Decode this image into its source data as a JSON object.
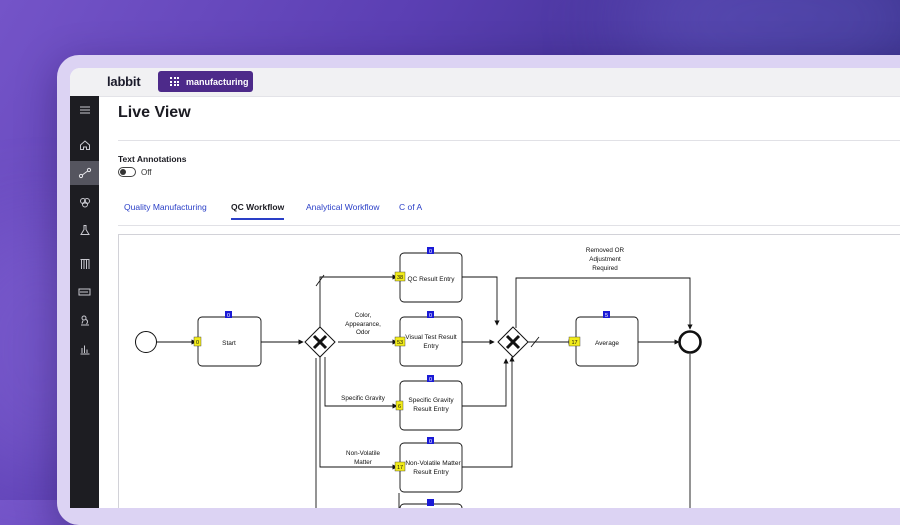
{
  "app": {
    "logo": "labbit",
    "workspace": "manufacturing"
  },
  "sidebar": {
    "items": [
      {
        "icon": "menu-icon"
      },
      {
        "icon": "home-icon"
      },
      {
        "icon": "workflow-icon",
        "active": true
      },
      {
        "icon": "samples-icon"
      },
      {
        "icon": "flask-icon"
      },
      {
        "icon": "test-tubes-icon"
      },
      {
        "icon": "battery-icon"
      },
      {
        "icon": "microscope-icon"
      },
      {
        "icon": "bar-chart-icon"
      }
    ]
  },
  "page": {
    "title": "Live View",
    "annotations_label": "Text Annotations",
    "annotations_state": "Off"
  },
  "tabs": [
    {
      "label": "Quality Manufacturing",
      "active": false
    },
    {
      "label": "QC Workflow",
      "active": true
    },
    {
      "label": "Analytical Workflow",
      "active": false
    },
    {
      "label": "C of A",
      "active": false
    }
  ],
  "workflow": {
    "tasks": {
      "start": {
        "label": "Start",
        "top_count": "0",
        "side_count": "0"
      },
      "qc_result": {
        "label": "QC Result Entry",
        "top_count": "0",
        "side_count": "38"
      },
      "visual": {
        "label1": "Visual Test Result",
        "label2": "Entry",
        "top_count": "0",
        "side_count": "53"
      },
      "gravity": {
        "label1": "Specific Gravity",
        "label2": "Result Entry",
        "top_count": "0",
        "side_count": "6"
      },
      "nonvolatile": {
        "label1": "Non-Volatile Matter",
        "label2": "Result Entry",
        "top_count": "0",
        "side_count": "17"
      },
      "average": {
        "label": "Average",
        "top_count": "5",
        "side_count": "17"
      }
    },
    "edge_labels": {
      "color": [
        "Color,",
        "Appearance,",
        "Odor"
      ],
      "gravity": "Specific Gravity",
      "nonvolatile": [
        "Non-Volatile",
        "Matter"
      ],
      "removed": [
        "Removed OR",
        "Adjustment",
        "Required"
      ]
    },
    "colors": {
      "top_badge": "#1a1ad6",
      "side_badge": "#f2ec1a"
    }
  }
}
